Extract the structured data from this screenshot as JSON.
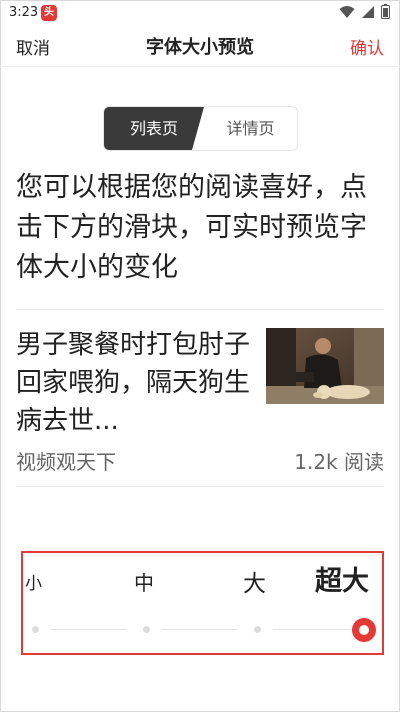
{
  "status_bar": {
    "time": "3:23",
    "app_badge_icon": "toutiao-app-icon",
    "icons": [
      "wifi-icon",
      "signal-icon",
      "battery-icon"
    ]
  },
  "header": {
    "cancel_label": "取消",
    "title": "字体大小预览",
    "confirm_label": "确认",
    "accent_color": "#e53935"
  },
  "tabs": {
    "active_label": "列表页",
    "inactive_label": "详情页"
  },
  "description": "您可以根据您的阅读喜好，点击下方的滑块，可实时预览字体大小的变化",
  "article": {
    "title": "男子聚餐时打包肘子回家喂狗，隔天狗生病去世...",
    "source": "视频观天下",
    "reads": "1.2k 阅读",
    "thumbnail": "man-with-dog-photo"
  },
  "font_slider": {
    "labels": [
      "小",
      "中",
      "大",
      "超大"
    ],
    "selected": "超大",
    "selected_index": 3
  }
}
